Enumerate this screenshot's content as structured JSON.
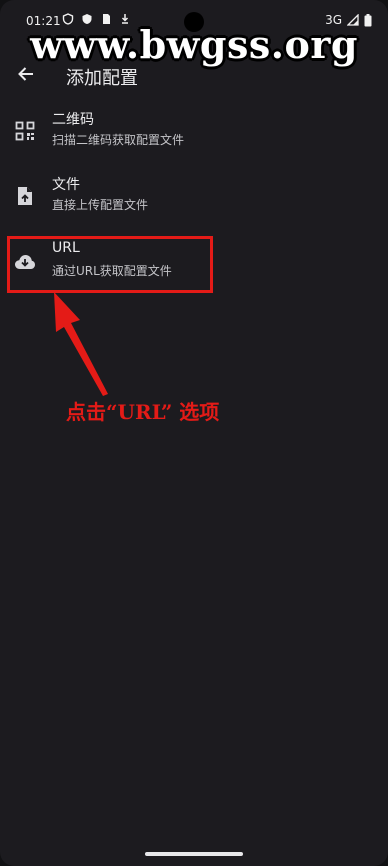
{
  "status_bar": {
    "time": "01:21",
    "network": "3G",
    "icons": [
      "shield-icon",
      "sim-card-icon",
      "download-notification-icon",
      "signal-icon",
      "battery-icon"
    ]
  },
  "watermark": "www.bwgss.org",
  "app_bar": {
    "back_icon": "arrow-back-icon",
    "title": "添加配置"
  },
  "options": [
    {
      "icon": "qr-code-icon",
      "title": "二维码",
      "subtitle": "扫描二维码获取配置文件"
    },
    {
      "icon": "file-upload-icon",
      "title": "文件",
      "subtitle": "直接上传配置文件"
    },
    {
      "icon": "cloud-download-icon",
      "title": "URL",
      "subtitle": "通过URL获取配置文件"
    }
  ],
  "annotation": {
    "text": "点击“URL” 选项",
    "color": "#e41b17"
  },
  "colors": {
    "background": "#1c1b1f",
    "text_primary": "#ececee",
    "text_secondary": "#c5c5c9",
    "highlight": "#e41b17"
  }
}
